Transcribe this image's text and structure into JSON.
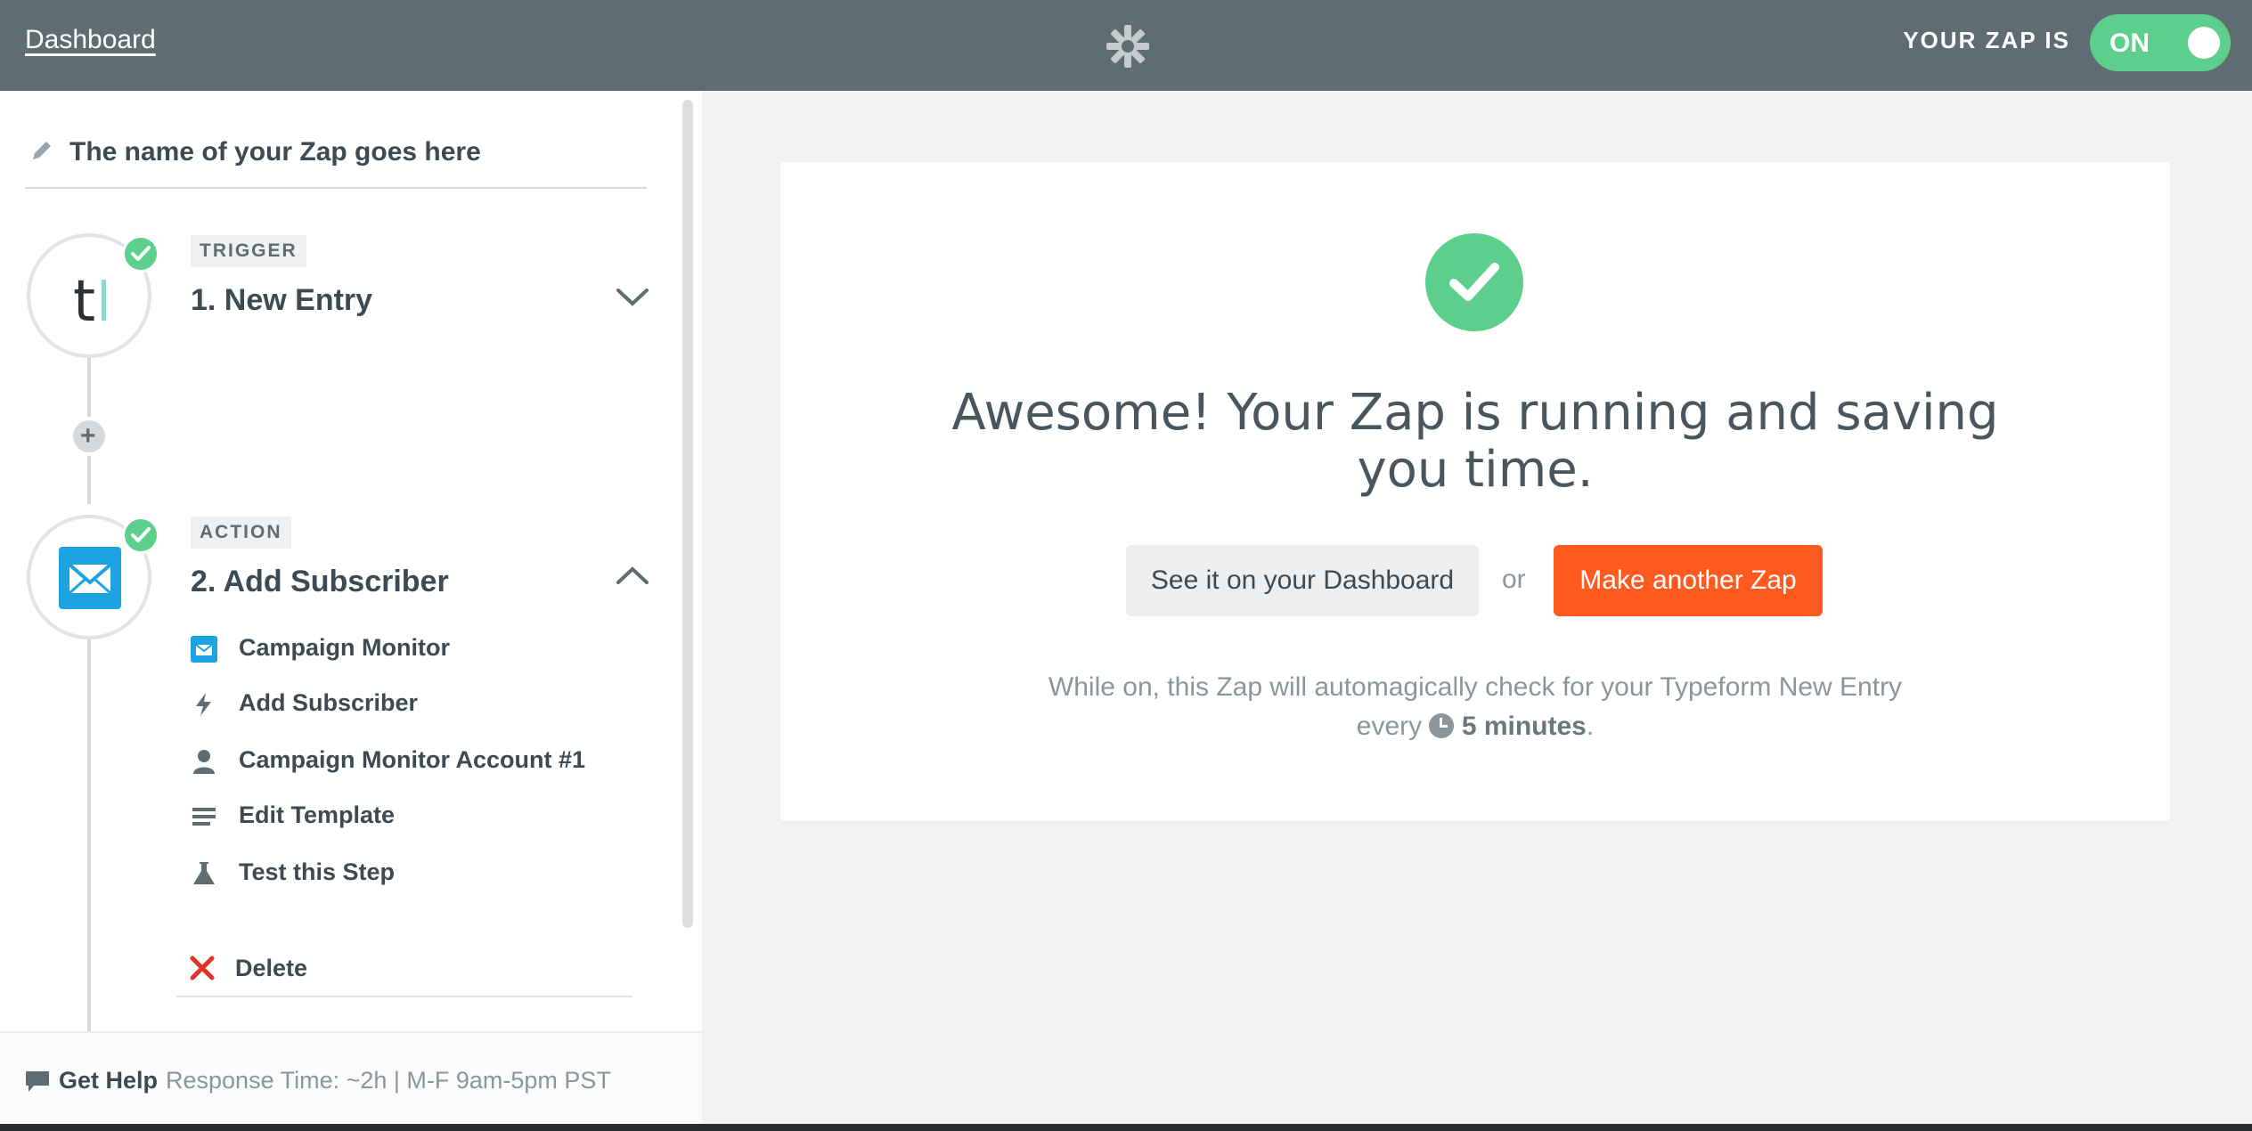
{
  "topbar": {
    "dashboard_link": "Dashboard",
    "zap_status_label": "YOUR ZAP IS",
    "toggle_label": "ON",
    "toggle_color": "#5ccf8c",
    "logo_icon": "zapier-asterisk-icon"
  },
  "sidebar": {
    "zap_name": "The name of your Zap goes here",
    "trigger": {
      "tag": "TRIGGER",
      "title": "1. New Entry",
      "app_icon": "typeform-logo",
      "app_letter": "t",
      "expanded": false
    },
    "action": {
      "tag": "ACTION",
      "title": "2. Add Subscriber",
      "app_icon": "campaign-monitor-logo",
      "expanded": true,
      "items": [
        {
          "label": "Campaign Monitor",
          "icon": "campaign-monitor-icon"
        },
        {
          "label": "Add Subscriber",
          "icon": "bolt-icon"
        },
        {
          "label": "Campaign Monitor Account #1",
          "icon": "user-icon"
        },
        {
          "label": "Edit Template",
          "icon": "lines-icon"
        },
        {
          "label": "Test this Step",
          "icon": "flask-icon"
        }
      ],
      "delete_label": "Delete"
    },
    "help": {
      "title": "Get Help",
      "info": "Response Time: ~2h | M-F 9am-5pm PST"
    }
  },
  "main": {
    "headline": "Awesome! Your Zap is running and saving you time.",
    "dashboard_button": "See it on your Dashboard",
    "or_text": "or",
    "make_button": "Make another Zap",
    "make_button_color": "#ff5a1f",
    "note_prefix": "While on, this Zap will automagically check for your Typeform New Entry every",
    "note_interval": "5 minutes",
    "note_suffix": "."
  }
}
